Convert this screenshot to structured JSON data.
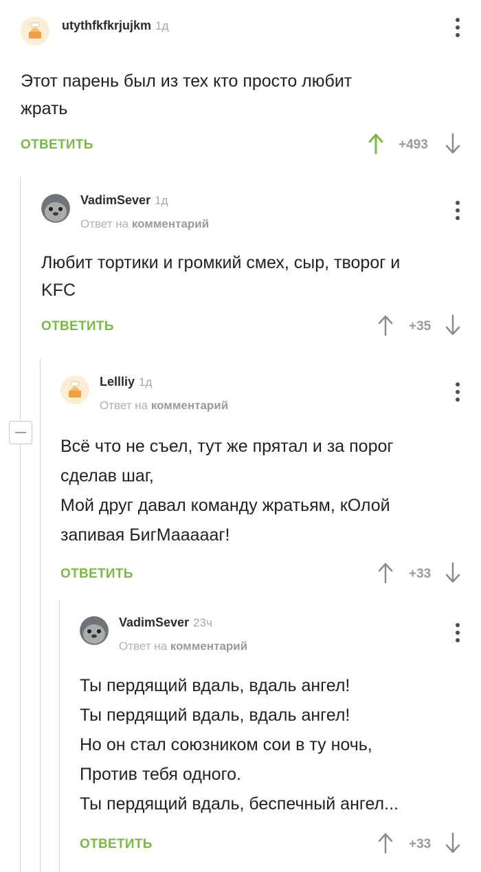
{
  "ui": {
    "reply_label": "ОТВЕТИТЬ",
    "reply_to_prefix": "Ответ на",
    "reply_to_target": "комментарий"
  },
  "colors": {
    "accent_green": "#7bb848",
    "upvoted_arrow": "#7bb848",
    "thread_line": "#d6d6d6"
  },
  "comments": [
    {
      "author": "utythfkfkrjujkm",
      "time": "1д",
      "avatar": "default-avatar-icon",
      "text": [
        "Этот парень был из тех кто просто любит",
        "жрать"
      ],
      "score": "+493",
      "upvoted": true
    },
    {
      "author": "VadimSever",
      "time": "1д",
      "avatar": "seal-avatar-icon",
      "text": [
        "Любит тортики и громкий смех, сыр, творог и",
        "KFC"
      ],
      "score": "+35",
      "upvoted": false
    },
    {
      "author": "Lellliy",
      "time": "1д",
      "avatar": "default-avatar-icon",
      "text": [
        "Всё что не съел, тут же прятал и за порог",
        "сделав шаг,",
        "Мой друг давал команду жратьям, кОлой",
        "запивая БигМаааааг!"
      ],
      "score": "+33",
      "upvoted": false
    },
    {
      "author": "VadimSever",
      "time": "23ч",
      "avatar": "seal-avatar-icon",
      "text": [
        "Ты пердящий вдаль, вдаль ангел!",
        "Ты пердящий вдаль, вдаль ангел!",
        "Но он стал союзником сои в ту ночь,",
        "Против тебя одного.",
        "Ты пердящий вдаль, беспечный ангел..."
      ],
      "score": "+33",
      "upvoted": false
    }
  ]
}
